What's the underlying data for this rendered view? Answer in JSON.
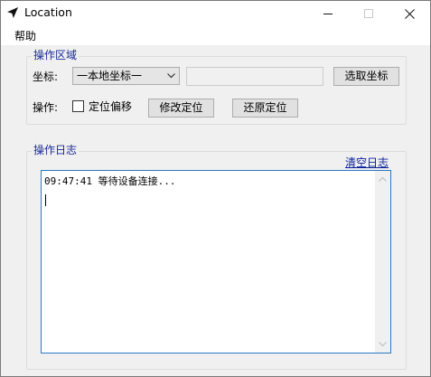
{
  "window": {
    "title": "Location",
    "icon": "navigation-arrow-icon"
  },
  "menu": {
    "items": [
      {
        "label": "帮助"
      }
    ]
  },
  "operation_group": {
    "title": "操作区域",
    "coord_label": "坐标:",
    "coord_select_value": "一本地坐标一",
    "coord_input_value": "",
    "pick_button": "选取坐标",
    "op_label": "操作:",
    "offset_checkbox_label": "定位偏移",
    "offset_checked": false,
    "modify_button": "修改定位",
    "restore_button": "还原定位"
  },
  "log_group": {
    "title": "操作日志",
    "clear_link": "清空日志",
    "text": "09:47:41 等待设备连接..."
  },
  "colors": {
    "group_title": "#1a2a9a",
    "link": "#0a1e9a",
    "log_border": "#2b79c2"
  }
}
